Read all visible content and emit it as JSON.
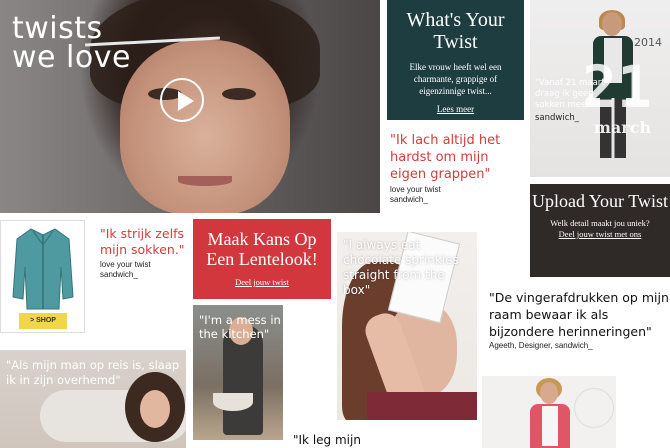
{
  "hero": {
    "title_line1": "twists",
    "title_line2": "we love",
    "play_label": "play-video"
  },
  "whats_your_twist": {
    "heading": "What's Your Twist",
    "text": "Elke vrouw heeft wel een charmante, grappige of eigenzinnige twist...",
    "link": "Lees meer"
  },
  "fashion_top": {
    "year": "2014",
    "day": "21",
    "month": "march",
    "quote": "\"Vanaf 21 maart draag ik geen sokken meer\"",
    "byline": "sandwich_"
  },
  "quote_lach": {
    "text": "\"Ik lach altijd het hardst om mijn eigen grappen\"",
    "byline_1": "love your twist",
    "byline_2": "sandwich_"
  },
  "upload": {
    "heading": "Upload Your Twist",
    "text": "Welk detail maakt jou uniek?",
    "link": "Deel jouw twist met ons"
  },
  "jacket": {
    "shop_label": "> SHOP",
    "jacket_color": "#4f9aa0"
  },
  "quote_strijk": {
    "text": "\"Ik strijk zelfs mijn sokken.\"",
    "byline_1": "love your twist",
    "byline_2": "sandwich_"
  },
  "maak_kans": {
    "heading": "Maak Kans Op Een Lentelook!",
    "link": "Deel jouw twist"
  },
  "chocolate": {
    "quote": "\"I always eat chocolate sprinkles straight from the box\""
  },
  "quote_vinger": {
    "text": "\"De vingerafdrukken op mijn raam bewaar ik als bijzondere herinneringen\"",
    "byline": "Ageeth, Designer, sandwich_"
  },
  "kitchen": {
    "quote": "\"I'm a mess in the kitchen\""
  },
  "lying": {
    "quote": "\"Als mijn man op reis is, slaap ik in zijn overhemd\""
  },
  "bottom_quote": {
    "text": "\"Ik leg mijn"
  },
  "colors": {
    "accent_red": "#d23c3c",
    "teal_dark": "#1d3d40",
    "brown_dark": "#2f2a27",
    "shop_yellow": "#f2d64a"
  }
}
